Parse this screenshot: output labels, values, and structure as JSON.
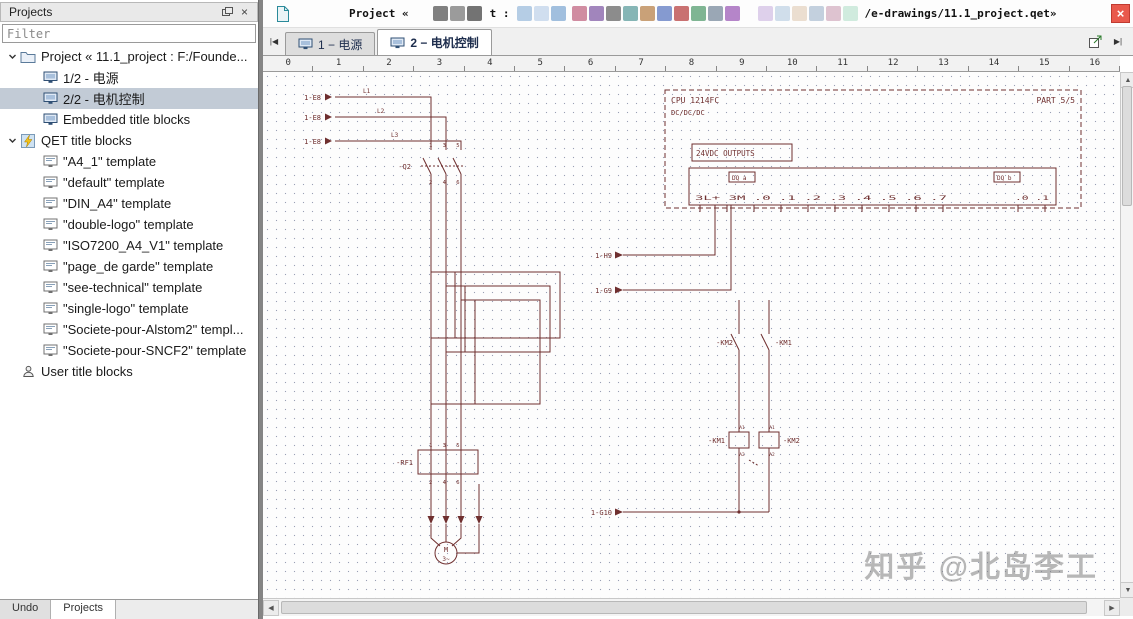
{
  "sidebar": {
    "title": "Projects",
    "filter_placeholder": "Filter",
    "tree": [
      {
        "label": "Project « 11.1_project : F:/Founde...",
        "icon": "folder",
        "level": 0,
        "expander": true,
        "selected": false
      },
      {
        "label": "1/2 - 电源",
        "icon": "diagram",
        "level": 1,
        "expander": false,
        "selected": false
      },
      {
        "label": "2/2 - 电机控制",
        "icon": "diagram",
        "level": 1,
        "expander": false,
        "selected": true
      },
      {
        "label": "Embedded title blocks",
        "icon": "diagram",
        "level": 1,
        "expander": false,
        "selected": false
      },
      {
        "label": "QET title blocks",
        "icon": "lightning",
        "level": 0,
        "expander": true,
        "selected": false
      },
      {
        "label": "\"A4_1\" template",
        "icon": "template",
        "level": 1,
        "expander": false,
        "selected": false
      },
      {
        "label": "\"default\" template",
        "icon": "template",
        "level": 1,
        "expander": false,
        "selected": false
      },
      {
        "label": "\"DIN_A4\" template",
        "icon": "template",
        "level": 1,
        "expander": false,
        "selected": false
      },
      {
        "label": "\"double-logo\" template",
        "icon": "template",
        "level": 1,
        "expander": false,
        "selected": false
      },
      {
        "label": "\"ISO7200_A4_V1\" template",
        "icon": "template",
        "level": 1,
        "expander": false,
        "selected": false
      },
      {
        "label": "\"page_de garde\" template",
        "icon": "template",
        "level": 1,
        "expander": false,
        "selected": false
      },
      {
        "label": "\"see-technical\" template",
        "icon": "template",
        "level": 1,
        "expander": false,
        "selected": false
      },
      {
        "label": "\"single-logo\" template",
        "icon": "template",
        "level": 1,
        "expander": false,
        "selected": false
      },
      {
        "label": "\"Societe-pour-Alstom2\" templ...",
        "icon": "template",
        "level": 1,
        "expander": false,
        "selected": false
      },
      {
        "label": "\"Societe-pour-SNCF2\" template",
        "icon": "template",
        "level": 1,
        "expander": false,
        "selected": false
      },
      {
        "label": "User title blocks",
        "icon": "user",
        "level": 0,
        "expander": false,
        "selected": false
      }
    ],
    "bottom_tabs": [
      "Undo",
      "Projects"
    ]
  },
  "header": {
    "title_left": "Project «",
    "title_mid": "t :",
    "title_right": "/e-drawings/11.1_project.qet»",
    "clusters": {
      "a": [
        "#6a6a6a",
        "#8a8a8a",
        "#5a5a5a"
      ],
      "b": [
        "#a8c4e0",
        "#c8d8ec",
        "#90b4d8"
      ],
      "c": [
        "#c87890",
        "#9070b0",
        "#787878",
        "#70a8a8",
        "#c09060",
        "#7088c8",
        "#c05858",
        "#68a880",
        "#8898a8",
        "#a870c0"
      ],
      "d": [
        "#d8c8e8",
        "#c8d8e8",
        "#e8d8c8",
        "#b8c8d8",
        "#d8b8c8",
        "#c8e8d8"
      ]
    }
  },
  "icons": {
    "close": "×",
    "left": "◀",
    "right": "▶",
    "up": "▲",
    "down": "▼",
    "first": "|◀",
    "last": "▶|"
  },
  "tabs": [
    {
      "label": "1 − 电源",
      "active": false
    },
    {
      "label": "2 − 电机控制",
      "active": true
    }
  ],
  "ruler": [
    "0",
    "1",
    "2",
    "3",
    "4",
    "5",
    "6",
    "7",
    "8",
    "9",
    "10",
    "11",
    "12",
    "13",
    "14",
    "15",
    "16"
  ],
  "schematic": {
    "e8": "1-E8",
    "l1": "L1",
    "l2": "L2",
    "l3": "L3",
    "q2": "-Q2",
    "q2_top": "1 3 5",
    "q2_bot": "2 4 6",
    "rf1": "-RF1",
    "rf1_top": "1 3 5",
    "rf1_bot": "2 4 6",
    "motor_m": "M",
    "motor_ph": "3~",
    "cpu_title": "CPU 1214FC",
    "cpu_sub": "DC/DC/DC",
    "cpu_part": "PART 5/5",
    "outputs": "24VDC OUTPUTS",
    "dq_a": "DQ a",
    "dq_b": "DQ b",
    "pins_a": "3L+ 3M .0 .1 .2 .3 .4 .5 .6 .7",
    "pins_b": ".0 .1",
    "ref_h9": "1-H9",
    "ref_g9": "1-G9",
    "ref_g10": "1-G10",
    "km2_contact": "-KM2",
    "km1_contact": "-KM1",
    "km1_coil": "-KM1",
    "km2_coil": "-KM2",
    "a1": "A1",
    "a2": "A2"
  },
  "watermark": "知乎 @北岛李工",
  "colors": {
    "schematic": "#6f2f2f",
    "selection": "#c2cbd6",
    "close_red": "#e9594c"
  }
}
